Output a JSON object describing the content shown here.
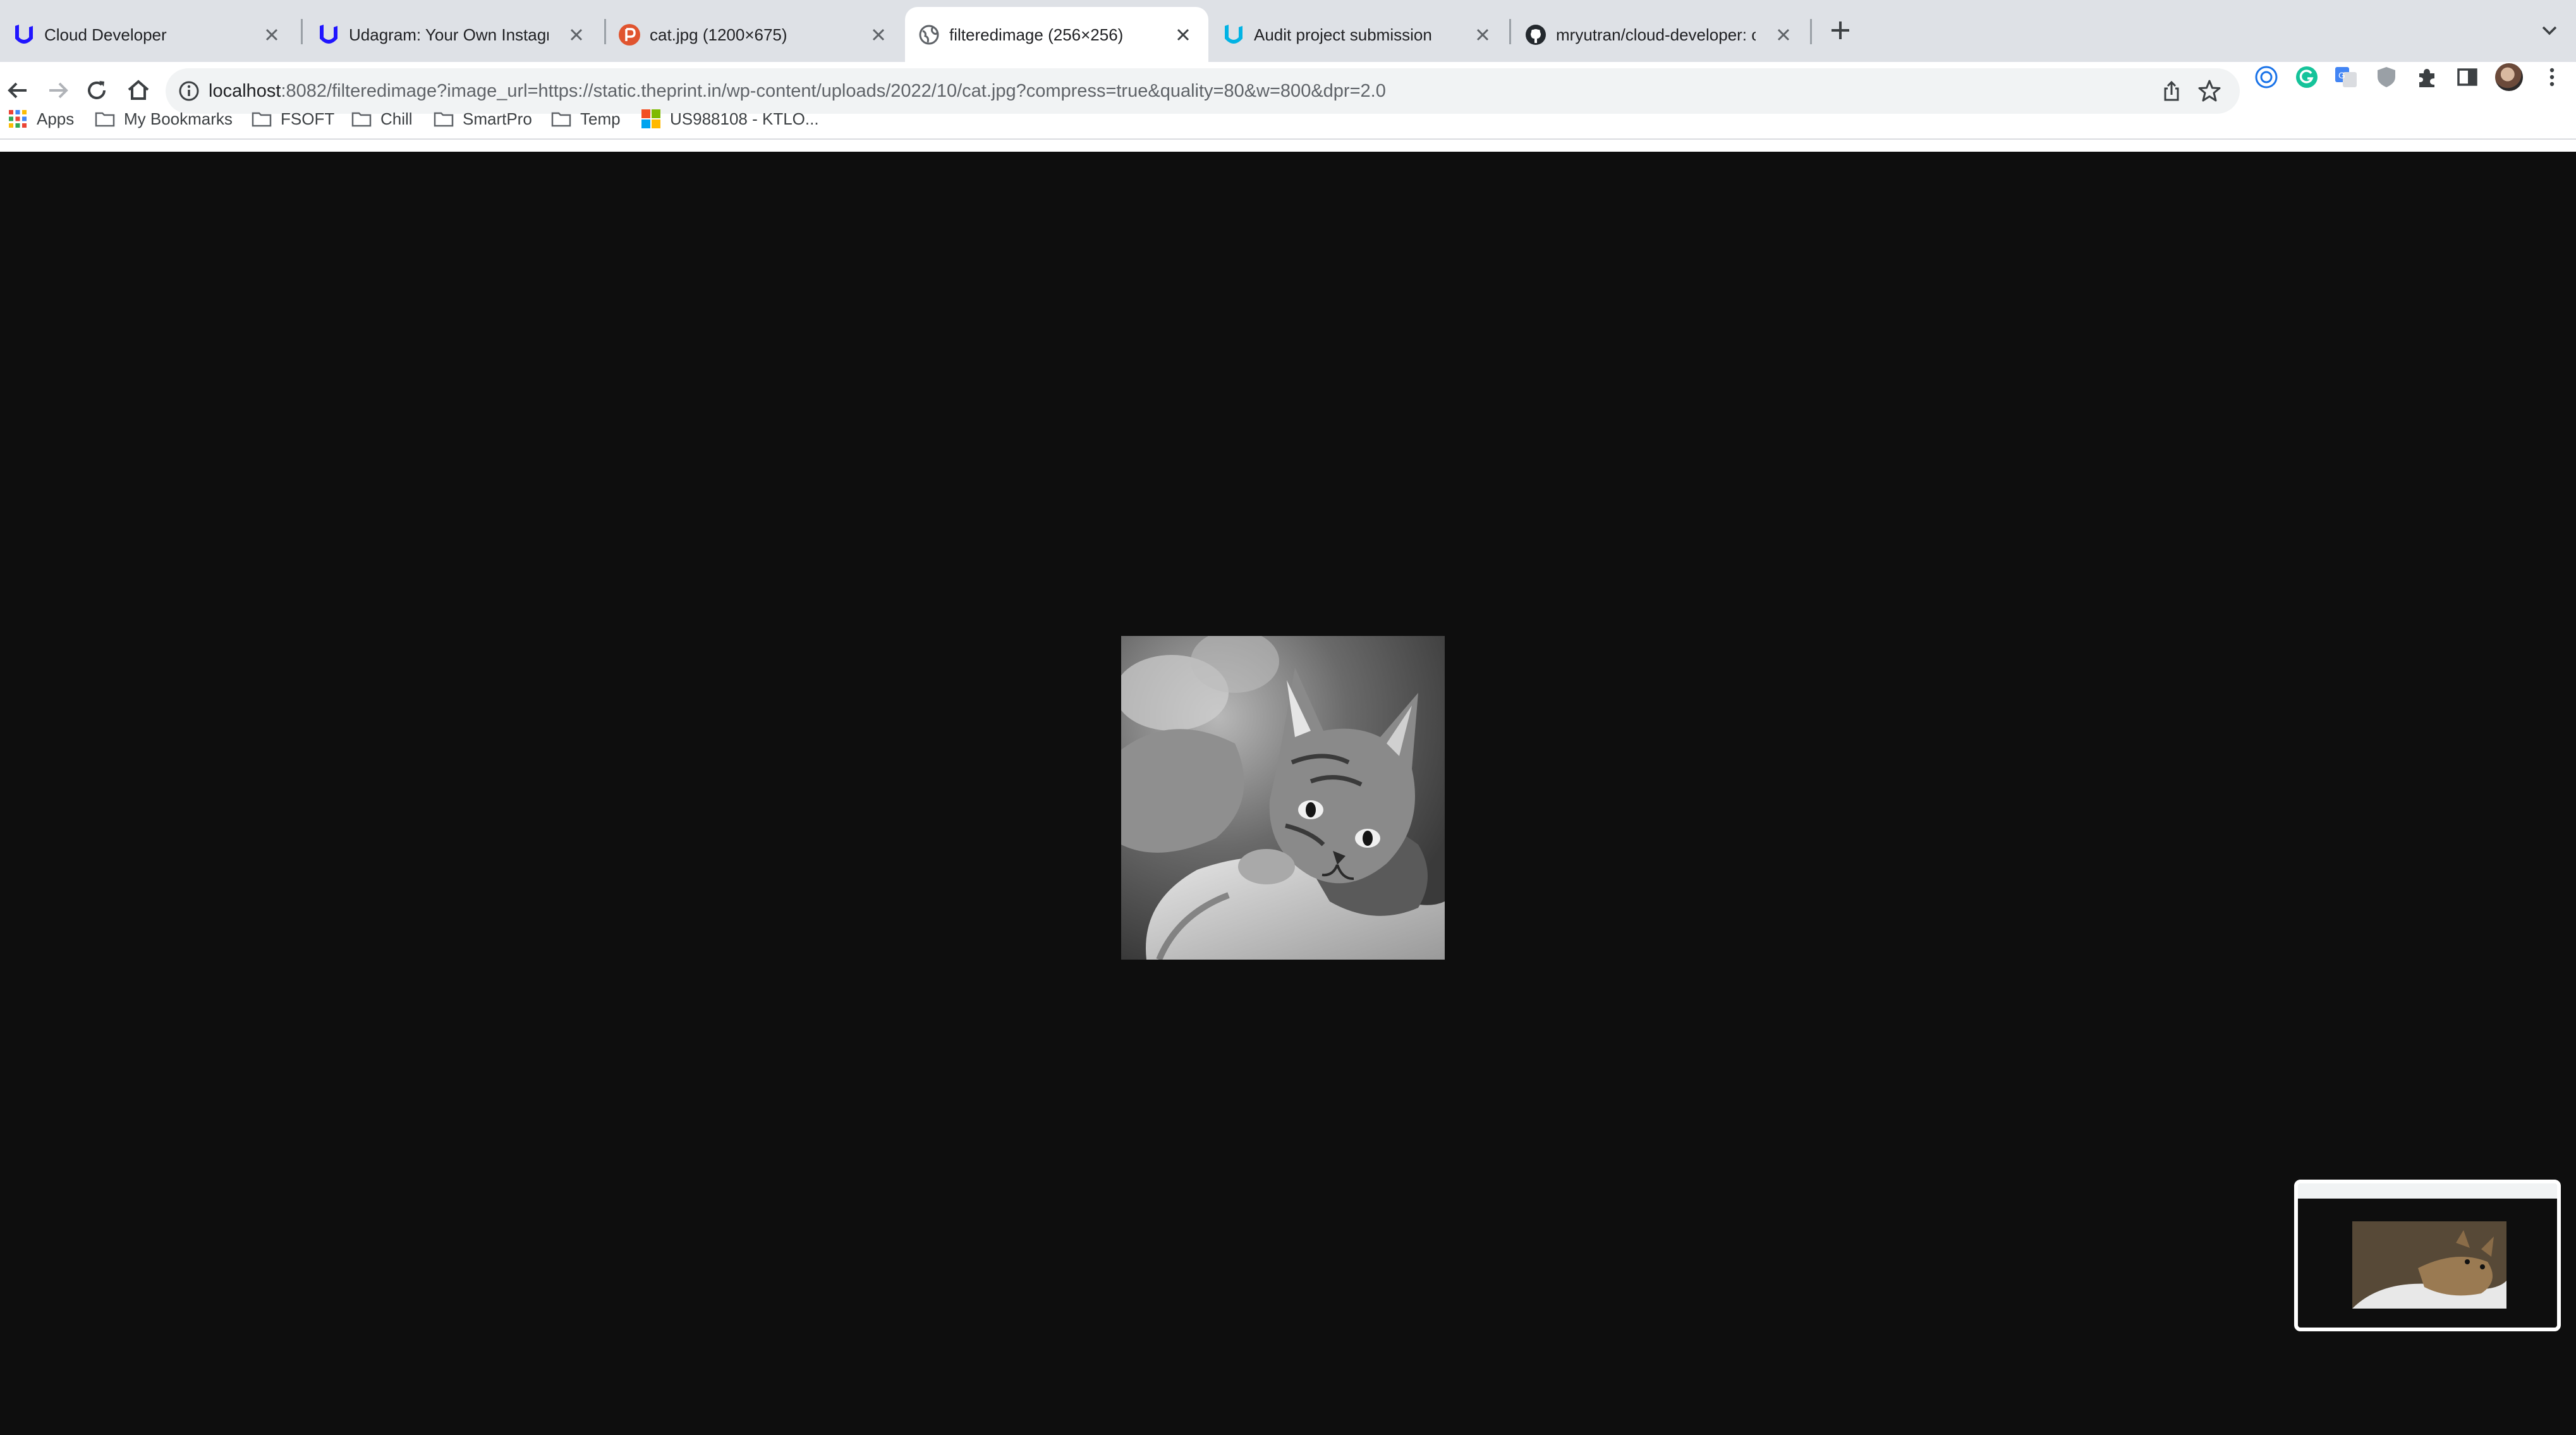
{
  "tabs": [
    {
      "title": "Cloud Developer",
      "icon": "udacity-icon",
      "active": false
    },
    {
      "title": "Udagram: Your Own Instagram",
      "icon": "udacity-icon",
      "active": false
    },
    {
      "title": "cat.jpg (1200×675)",
      "icon": "theprint-icon",
      "active": false
    },
    {
      "title": "filteredimage (256×256)",
      "icon": "globe-icon",
      "active": true
    },
    {
      "title": "Audit project submission",
      "icon": "udacity-icon",
      "active": false
    },
    {
      "title": "mryutran/cloud-developer: cou",
      "icon": "github-icon",
      "active": false
    }
  ],
  "address_bar": {
    "host": "localhost",
    "rest": ":8082/filteredimage?image_url=https://static.theprint.in/wp-content/uploads/2022/10/cat.jpg?compress=true&quality=80&w=800&dpr=2.0"
  },
  "bookmarks": [
    {
      "label": "Apps",
      "icon": "apps-grid-icon"
    },
    {
      "label": "My Bookmarks",
      "icon": "folder-icon"
    },
    {
      "label": "FSOFT",
      "icon": "folder-icon"
    },
    {
      "label": "Chill",
      "icon": "folder-icon"
    },
    {
      "label": "SmartPro",
      "icon": "folder-icon"
    },
    {
      "label": "Temp",
      "icon": "folder-icon"
    },
    {
      "label": "US988108 - KTLO...",
      "icon": "microsoft-icon"
    }
  ],
  "colors": {
    "page_background": "#0e0e0e",
    "tab_strip": "#dee1e6",
    "udacity_blue": "#2015ff",
    "theprint_red": "#e0542f"
  }
}
